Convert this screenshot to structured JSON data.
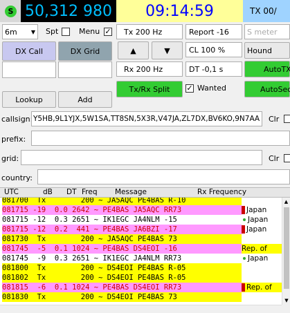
{
  "header": {
    "frequency": "50,312 980",
    "time": "09:14:59",
    "tx_label": "TX 00/",
    "status_icon": "S",
    "colors": {
      "freq_bg": "#000000",
      "freq_fg": "#00bfff",
      "time_bg": "#ffff99",
      "time_fg": "#0000ff",
      "tx_bg": "#9fd3ff",
      "green": "#33cc33"
    }
  },
  "controls": {
    "band": "6m",
    "spt_label": "Spt",
    "menu_label": "Menu",
    "tx_freq": "Tx  200  Hz",
    "rx_freq": "Rx  200  Hz",
    "report": "Report -16",
    "s_meter": "S meter",
    "cl": "CL  100 %",
    "dt": "DT  -0,1 s",
    "hound": "Hound",
    "autotx": "AutoTX",
    "autoseq": "AutoSeq",
    "dx_call": "DX Call",
    "dx_grid": "DX Grid",
    "lookup": "Lookup",
    "add": "Add",
    "tx_rx_split": "Tx/Rx Split",
    "wanted": "Wanted",
    "up_arrow": "▲",
    "down_arrow": "▼",
    "check_mark": "✓"
  },
  "filters": {
    "callsign_label": "callsign:",
    "callsign_value": "Y5HB,9L1YJX,5W1SA,TT8SN,5X3R,V47JA,ZL7DX,BV6KO,9N7AA",
    "prefix_label": "prefix:",
    "grid_label": "grid:",
    "country_label": "country:",
    "clr_label": "Clr"
  },
  "table": {
    "headers": {
      "utc": "UTC",
      "db": "dB",
      "dt": "DT",
      "freq": "Freq",
      "message": "Message",
      "rx_freq": "Rx Frequency"
    },
    "rows": [
      {
        "text": "081700  Tx        200 ~ JA5AQC PE4BAS R-10",
        "bg": "#ffff00",
        "fg": "#000000"
      },
      {
        "text": "081715 -19  0.0 2642 ~ PE4BAS JA5AQC RR73",
        "bg": "#ff99ff",
        "fg": "#cc0000"
      },
      {
        "text": "081715 -12  0.3 2651 ~ IK1EGC JA4NLM -15",
        "bg": "#ffffff",
        "fg": "#000000"
      },
      {
        "text": "081715 -12  0.2  441 ~ PE4BAS JA6BZI -17",
        "bg": "#ff99ff",
        "fg": "#cc0000"
      },
      {
        "text": "081730  Tx        200 ~ JA5AQC PE4BAS 73",
        "bg": "#ffff00",
        "fg": "#000000"
      },
      {
        "text": "081745  -5  0.1 1024 ~ PE4BAS DS4EOI -16",
        "bg": "#ff99ff",
        "fg": "#cc0000"
      },
      {
        "text": "081745  -9  0.3 2651 ~ IK1EGC JA4NLM RR73",
        "bg": "#ffffff",
        "fg": "#000000"
      },
      {
        "text": "081800  Tx        200 ~ DS4EOI PE4BAS R-05",
        "bg": "#ffff00",
        "fg": "#000000"
      },
      {
        "text": "081802  Tx        200 ~ DS4EOI PE4BAS R-05",
        "bg": "#ffff00",
        "fg": "#000000"
      },
      {
        "text": "081815  -6  0.1 1024 ~ PE4BAS DS4EOI RR73",
        "bg": "#ff99ff",
        "fg": "#cc0000"
      },
      {
        "text": "081830  Tx        200 ~ DS4EOI PE4BAS 73",
        "bg": "#ffff00",
        "fg": "#000000"
      }
    ],
    "rx_entries": [
      {
        "text": "",
        "bg": "#ffffff",
        "flag": ""
      },
      {
        "text": "Japan",
        "bg": "#ffffff",
        "flag": "#cc0000"
      },
      {
        "text": "Japan",
        "bg": "#ffffff",
        "flag": "dot"
      },
      {
        "text": "Japan",
        "bg": "#ffffff",
        "flag": "#cc0000"
      },
      {
        "text": "",
        "bg": "#ffffff",
        "flag": ""
      },
      {
        "text": "Rep. of",
        "bg": "#ffff00",
        "flag": ""
      },
      {
        "text": "Japan",
        "bg": "#ffffff",
        "flag": "dot"
      },
      {
        "text": "",
        "bg": "#ffffff",
        "flag": ""
      },
      {
        "text": "",
        "bg": "#ffffff",
        "flag": ""
      },
      {
        "text": "Rep. of",
        "bg": "#ffff00",
        "flag": "#cc0000"
      },
      {
        "text": "",
        "bg": "#ffffff",
        "flag": ""
      }
    ],
    "scroll_up": "▲",
    "scroll_down": "▼"
  }
}
